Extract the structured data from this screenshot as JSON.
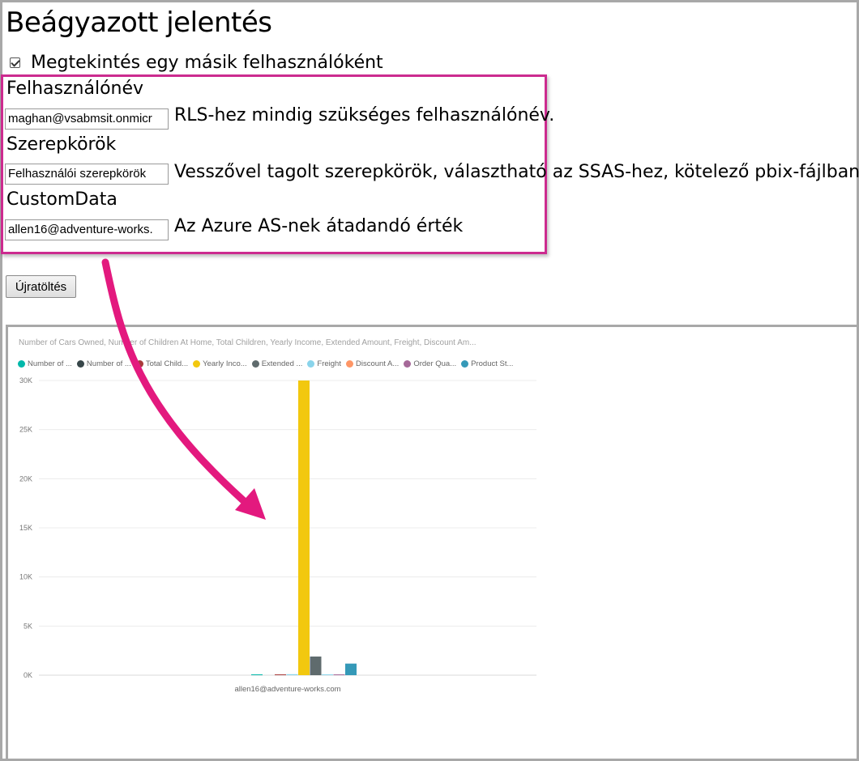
{
  "page": {
    "title": "Beágyazott jelentés",
    "view_as_label": "Megtekintés egy másik felhasználóként",
    "view_as_checked": true,
    "reload_label": "Újratöltés"
  },
  "fields": [
    {
      "label": "Felhasználónév",
      "value": "maghan@vsabmsit.onmicr",
      "hint": "RLS-hez mindig szükséges felhasználónév."
    },
    {
      "label": "Szerepkörök",
      "value": "Felhasználói szerepkörök",
      "hint": "Vesszővel tagolt szerepkörök, választható az SSAS-hez, kötelező pbix-fájlban..."
    },
    {
      "label": "CustomData",
      "value": "allen16@adventure-works.",
      "hint": "Az Azure AS-nek átadandó érték"
    }
  ],
  "colors": {
    "highlight": "#cc2b8f",
    "arrow": "#e3197e"
  },
  "report": {
    "title": "Number of Cars Owned, Number of Children At Home, Total Children, Yearly Income, Extended Amount, Freight, Discount Am...",
    "legend": [
      {
        "label": "Number of ...",
        "color": "#01b8aa"
      },
      {
        "label": "Number of ...",
        "color": "#374649"
      },
      {
        "label": "Total Child...",
        "color": "#a83a3a"
      },
      {
        "label": "Yearly Inco...",
        "color": "#f2c80f"
      },
      {
        "label": "Extended ...",
        "color": "#5f6b6d"
      },
      {
        "label": "Freight",
        "color": "#8ad4eb"
      },
      {
        "label": "Discount A...",
        "color": "#fe9666"
      },
      {
        "label": "Order Qua...",
        "color": "#a66999"
      },
      {
        "label": "Product St...",
        "color": "#3599b8"
      }
    ]
  },
  "chart_data": {
    "type": "bar",
    "title": "Number of Cars Owned, Number of Children At Home, Total Children, Yearly Income, Extended Amount, Freight, Discount Am...",
    "categories": [
      "allen16@adventure-works.com"
    ],
    "series": [
      {
        "name": "Number of ...",
        "values": [
          2
        ],
        "color": "#01b8aa"
      },
      {
        "name": "Number of ...",
        "values": [
          0
        ],
        "color": "#374649"
      },
      {
        "name": "Total Child...",
        "values": [
          3
        ],
        "color": "#a83a3a"
      },
      {
        "name": "Freight",
        "values": [
          100
        ],
        "color": "#8ad4eb"
      },
      {
        "name": "Yearly Inco...",
        "values": [
          30000
        ],
        "color": "#f2c80f"
      },
      {
        "name": "Extended ...",
        "values": [
          1900
        ],
        "color": "#5f6b6d"
      },
      {
        "name": "Freight",
        "values": [
          60
        ],
        "color": "#8ad4eb"
      },
      {
        "name": "Order Qua...",
        "values": [
          80
        ],
        "color": "#a66999"
      },
      {
        "name": "Product St...",
        "values": [
          1180
        ],
        "color": "#3599b8"
      }
    ],
    "yticks": [
      "0K",
      "5K",
      "10K",
      "15K",
      "20K",
      "25K",
      "30K"
    ],
    "ylim": [
      0,
      30000
    ],
    "grid": true,
    "legend_position": "top-left"
  }
}
